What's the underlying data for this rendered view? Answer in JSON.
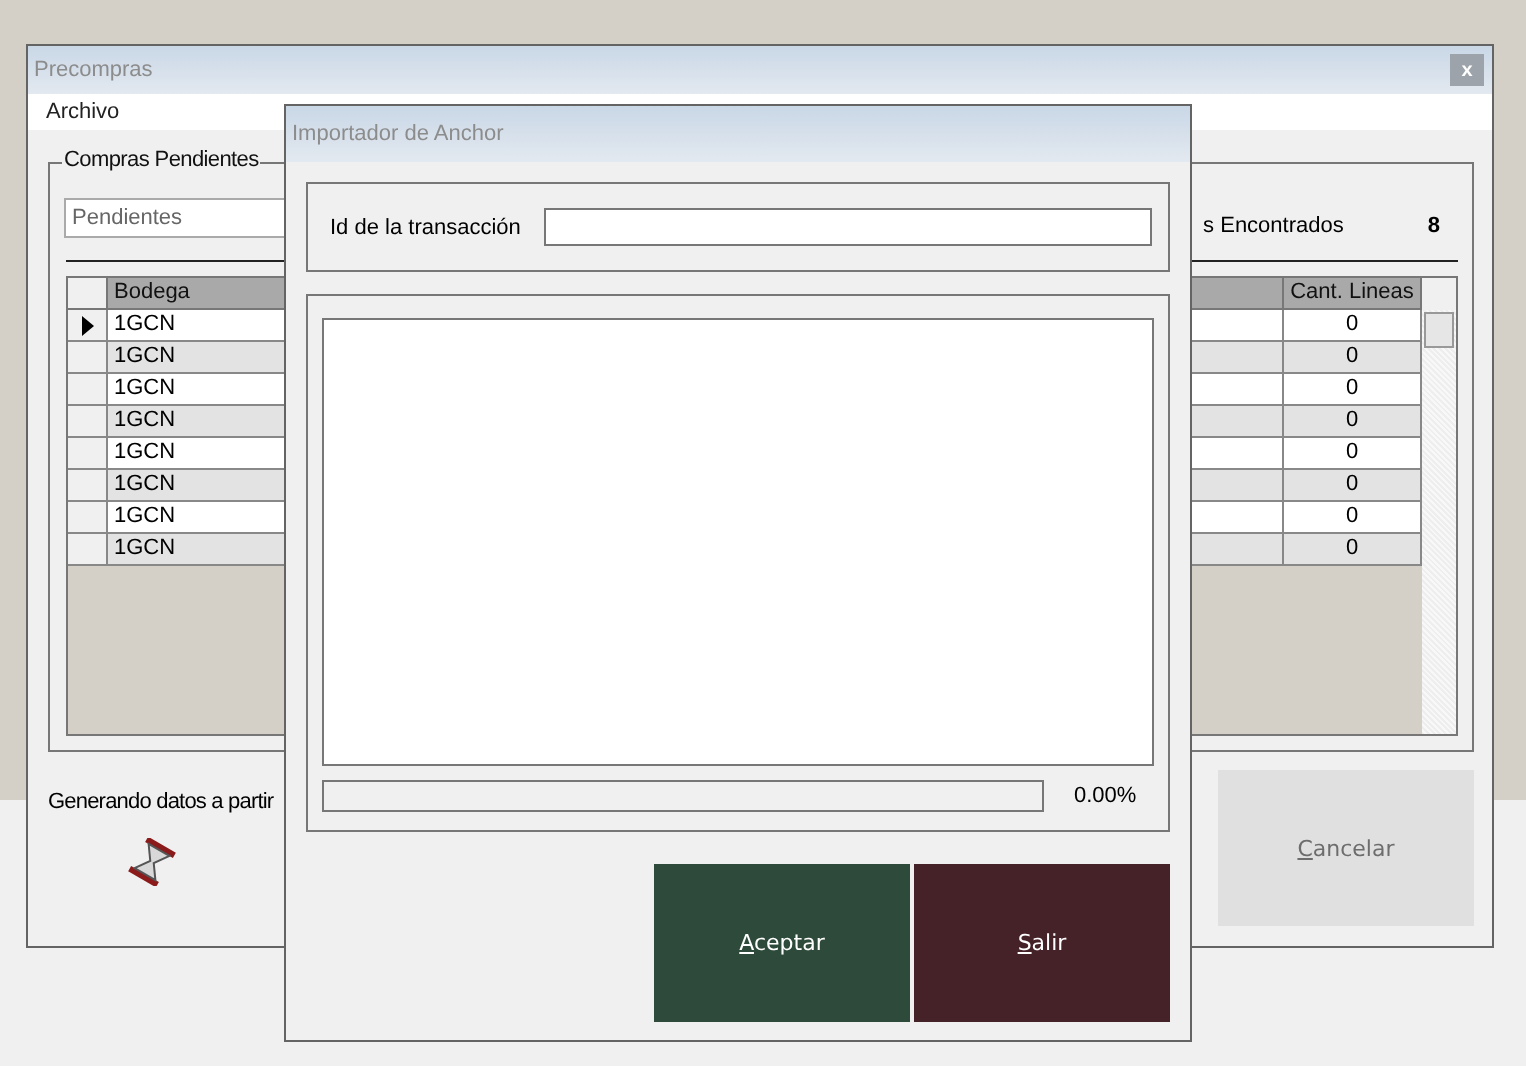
{
  "main_window": {
    "title": "Precompras",
    "close_button": "x",
    "menu": [
      {
        "label": "Archivo"
      }
    ],
    "group": {
      "title": "Compras Pendientes",
      "filter": {
        "value": "Pendientes"
      },
      "found_label": "s Encontrados",
      "found_count": "8",
      "table": {
        "columns": [
          "Bodega",
          "Cant. Lineas"
        ],
        "rows": [
          {
            "current": true,
            "cells": [
              "1GCN",
              "0"
            ]
          },
          {
            "current": false,
            "cells": [
              "1GCN",
              "0"
            ]
          },
          {
            "current": false,
            "cells": [
              "1GCN",
              "0"
            ]
          },
          {
            "current": false,
            "cells": [
              "1GCN",
              "0"
            ]
          },
          {
            "current": false,
            "cells": [
              "1GCN",
              "0"
            ]
          },
          {
            "current": false,
            "cells": [
              "1GCN",
              "0"
            ]
          },
          {
            "current": false,
            "cells": [
              "1GCN",
              "0"
            ]
          },
          {
            "current": false,
            "cells": [
              "1GCN",
              "0"
            ]
          }
        ]
      }
    },
    "status_text": "Generando datos a partir",
    "cancel_button": {
      "label": "Cancelar",
      "disabled": true,
      "mnemonic": true
    }
  },
  "dialog": {
    "title": "Importador de Anchor",
    "id_field": {
      "label": "Id de la transacción"
    },
    "progress": {
      "level": 0,
      "reading": "0.00%"
    },
    "buttons": [
      {
        "label": "Aceptar",
        "color": "#2e4a3a",
        "mnemonic": true
      },
      {
        "label": "Salir",
        "color": "#452128",
        "mnemonic": true
      }
    ]
  }
}
